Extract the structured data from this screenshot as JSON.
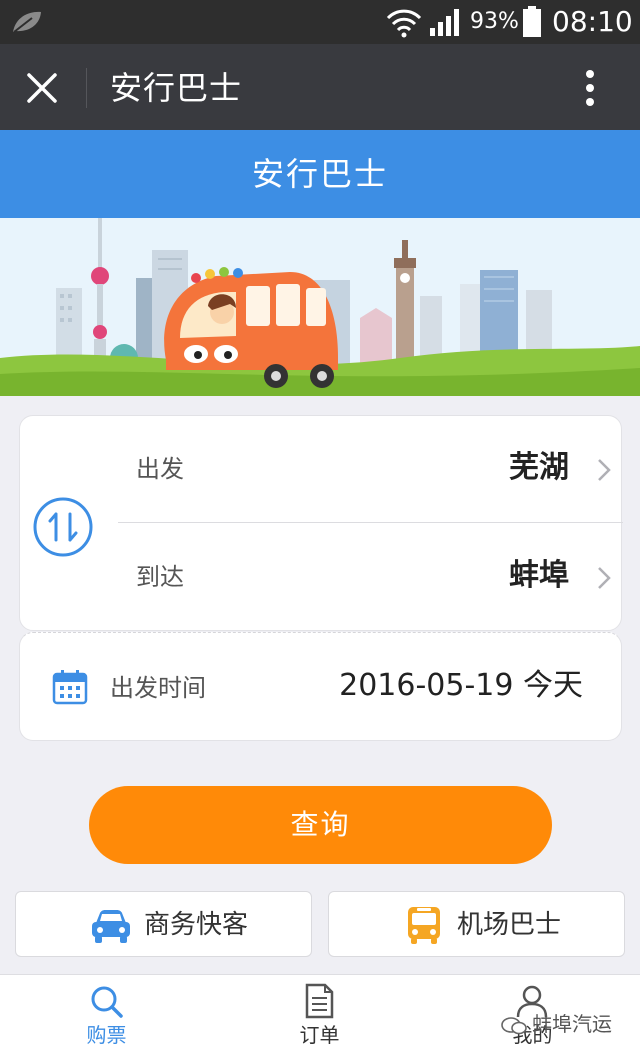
{
  "status_bar": {
    "battery_percent": "93%",
    "time": "08:10"
  },
  "app_header": {
    "title": "安行巴士",
    "close_icon": "close-icon",
    "more_icon": "more-vertical-icon"
  },
  "page": {
    "title": "安行巴士"
  },
  "route": {
    "depart_label": "出发",
    "depart_city": "芜湖",
    "arrive_label": "到达",
    "arrive_city": "蚌埠",
    "swap_icon": "swap-icon"
  },
  "date": {
    "label": "出发时间",
    "value": "2016-05-19 今天",
    "icon": "calendar-icon"
  },
  "actions": {
    "query_label": "查询"
  },
  "services": [
    {
      "label": "商务快客",
      "icon": "car-icon"
    },
    {
      "label": "机场巴士",
      "icon": "bus-icon"
    }
  ],
  "bottom_nav": [
    {
      "label": "购票",
      "icon": "search-icon",
      "active": true
    },
    {
      "label": "订单",
      "icon": "document-icon",
      "active": false
    },
    {
      "label": "我的",
      "icon": "user-icon",
      "active": false
    }
  ],
  "watermark": {
    "text": "蚌埠汽运"
  },
  "colors": {
    "header_dark": "#393a3f",
    "accent_blue": "#3d8ee4",
    "query_orange": "#ff8a08",
    "airport_yellow": "#f5a623"
  }
}
